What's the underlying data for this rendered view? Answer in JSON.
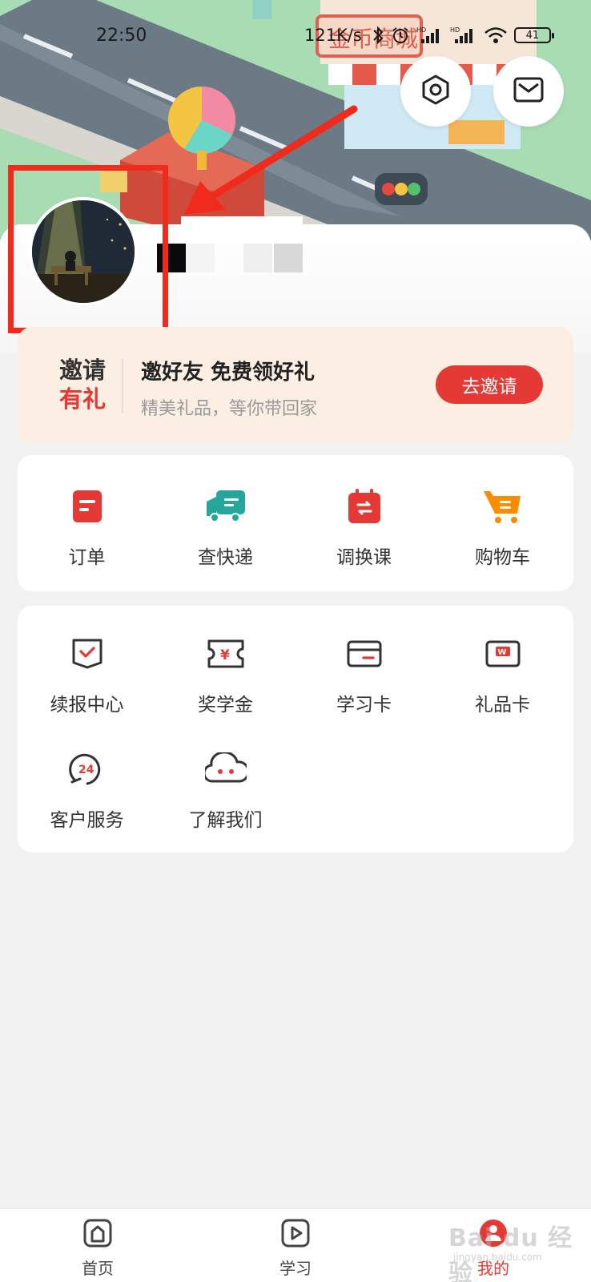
{
  "status_bar": {
    "time": "22:50",
    "net_speed": "121K/s",
    "battery": "41"
  },
  "header": {
    "shop_sign": "金币商城"
  },
  "invite": {
    "logo_line1": "邀请",
    "logo_line2": "有礼",
    "title": "邀好友 免费领好礼",
    "subtitle": "精美礼品，等你带回家",
    "button": "去邀请"
  },
  "orders_grid": [
    {
      "label": "订单",
      "icon": "order-icon"
    },
    {
      "label": "查快递",
      "icon": "truck-icon"
    },
    {
      "label": "调换课",
      "icon": "swap-course-icon"
    },
    {
      "label": "购物车",
      "icon": "cart-icon"
    }
  ],
  "services_grid": [
    {
      "label": "续报中心",
      "icon": "renew-icon"
    },
    {
      "label": "奖学金",
      "icon": "scholarship-icon"
    },
    {
      "label": "学习卡",
      "icon": "study-card-icon"
    },
    {
      "label": "礼品卡",
      "icon": "gift-card-icon"
    },
    {
      "label": "客户服务",
      "icon": "support-24-icon"
    },
    {
      "label": "了解我们",
      "icon": "about-us-icon"
    }
  ],
  "bottom_nav": [
    {
      "label": "首页",
      "icon": "home-icon",
      "active": false
    },
    {
      "label": "学习",
      "icon": "play-icon",
      "active": false
    },
    {
      "label": "我的",
      "icon": "profile-icon",
      "active": true
    }
  ],
  "watermark": {
    "text": "Bai du 经验",
    "sub": "jingyan.baidu.com"
  },
  "colors": {
    "accent": "#e53935",
    "truck": "#26a69a",
    "cart": "#fb8c00",
    "annotation": "#f02b1c"
  }
}
